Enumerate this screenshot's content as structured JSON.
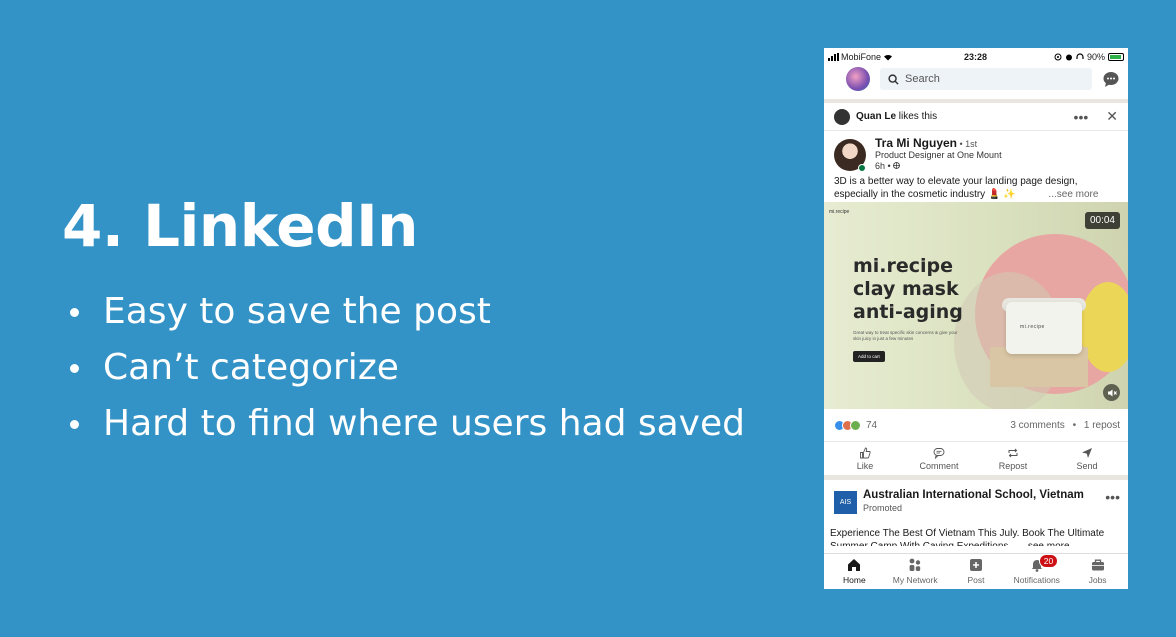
{
  "slide": {
    "title": "4. LinkedIn",
    "bullets": [
      "Easy to save the post",
      "Can’t categorize",
      "Hard to find where users had saved"
    ]
  },
  "statusbar": {
    "carrier": "MobiFone",
    "time": "23:28",
    "battery": "90%"
  },
  "topbar": {
    "search_placeholder": "Search"
  },
  "feed": {
    "social_context": {
      "name": "Quan Le",
      "action": " likes this",
      "more": "•••",
      "close": "✕"
    },
    "post": {
      "author_name": "Tra Mi Nguyen",
      "author_degree": " • 1st",
      "author_headline": "Product Designer at One Mount",
      "time_ago": "6h •",
      "text": "3D is a better way to elevate your landing page design, especially in the cosmetic industry 💄 ✨",
      "see_more": "...see more",
      "media": {
        "brand": "mi.recipe",
        "duration": "00:04",
        "headline": [
          "mi.recipe",
          "clay mask",
          "anti-aging"
        ],
        "subtext": "Great way to treat specific skin concerns & give your skin juicy in just a few minutes",
        "cta": "Add to cart",
        "jar_label": "mi.recipe"
      },
      "reactions_count": "74",
      "comments": "3 comments",
      "reposts": "1 repost",
      "separator": "•",
      "actions": [
        "Like",
        "Comment",
        "Repost",
        "Send"
      ]
    },
    "promo": {
      "logo": "AIS",
      "name": "Australian International School, Vietnam",
      "label": "Promoted",
      "more": "•••",
      "text": "Experience The Best Of Vietnam This July. Book The Ultimate Summer Camp With Caving Expeditions... ...see more"
    }
  },
  "bottomnav": {
    "items": [
      "Home",
      "My Network",
      "Post",
      "Notifications",
      "Jobs"
    ],
    "notifications_badge": "20"
  },
  "colors": {
    "background": "#3392C6",
    "linkedin_green": "#057642",
    "badge_red": "#cc1016"
  }
}
